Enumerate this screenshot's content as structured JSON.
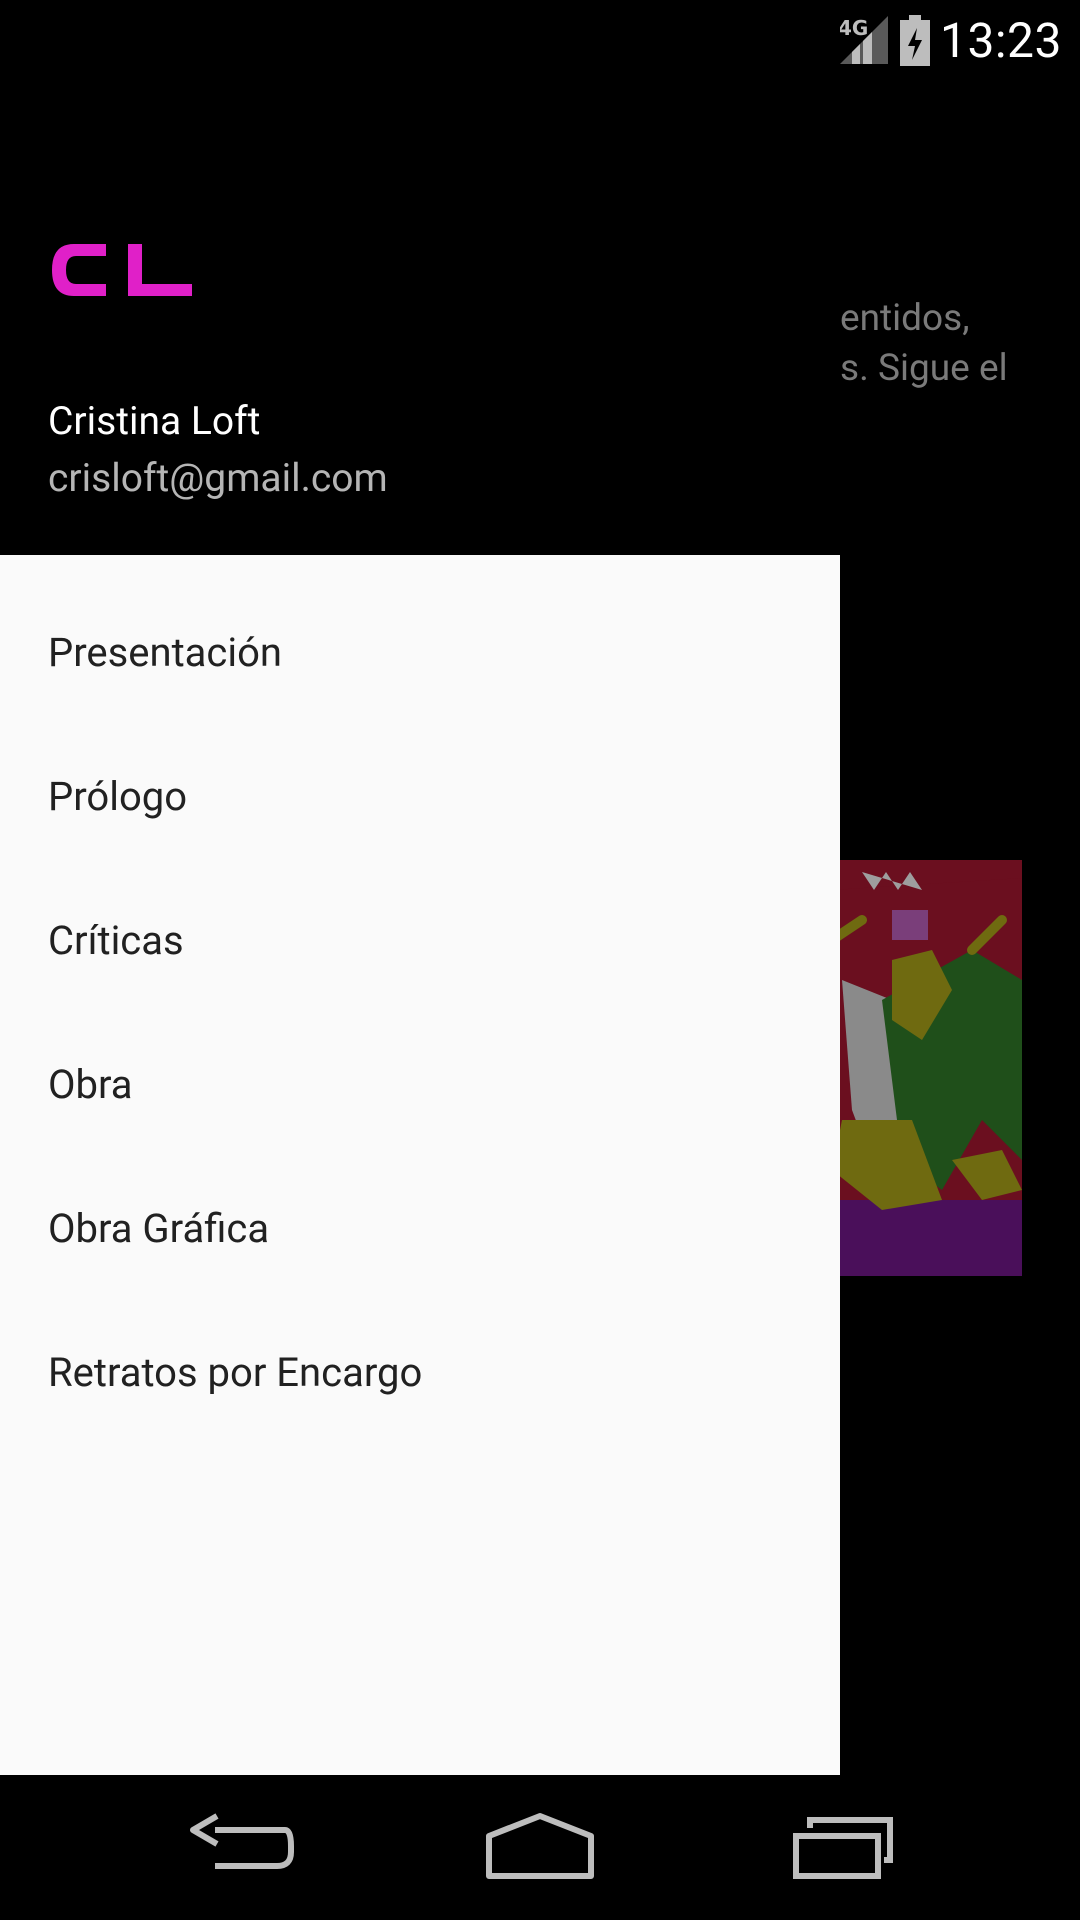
{
  "status_bar": {
    "network": "4G",
    "time": "13:23"
  },
  "background": {
    "text_line1": "entidos,",
    "text_line2": "s. Sigue el"
  },
  "drawer": {
    "logo_text": "CL",
    "user_name": "Cristina Loft",
    "user_email": "crisloft@gmail.com",
    "items": [
      {
        "label": "Presentación"
      },
      {
        "label": "Prólogo"
      },
      {
        "label": "Críticas"
      },
      {
        "label": "Obra"
      },
      {
        "label": "Obra Gráfica"
      },
      {
        "label": "Retratos por Encargo"
      }
    ]
  },
  "nav_bar": {
    "back": "back-icon",
    "home": "home-icon",
    "recents": "recents-icon"
  },
  "colors": {
    "brand_magenta": "#e020c8",
    "drawer_bg": "#fafafa",
    "header_bg": "#000000",
    "menu_text": "#212121"
  }
}
